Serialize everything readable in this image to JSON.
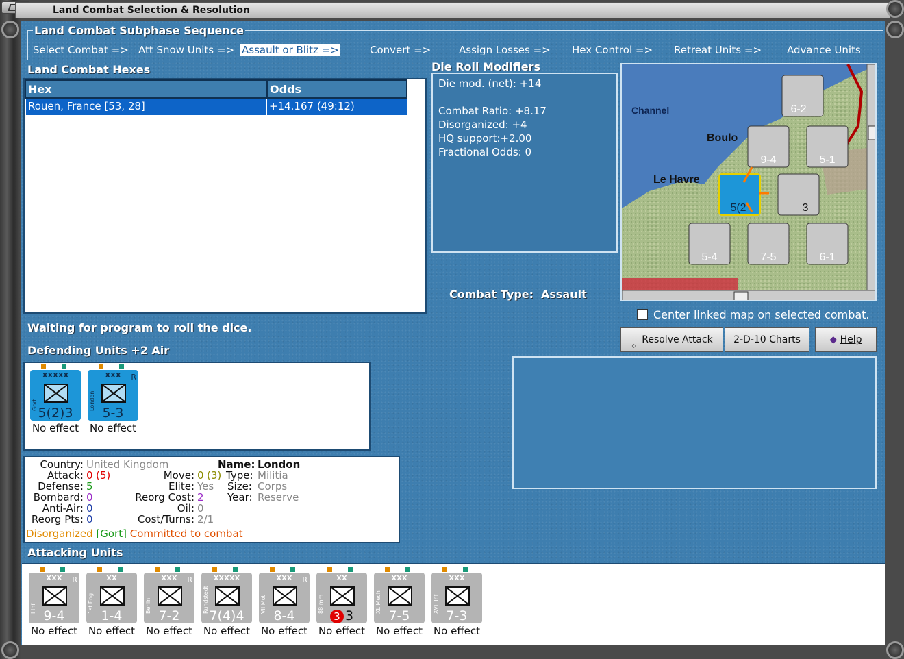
{
  "window": {
    "title": "Land Combat Selection & Resolution"
  },
  "phases": {
    "legend": "Land Combat Subphase Sequence",
    "items": [
      "Select Combat =>",
      "Att Snow Units =>",
      "Assault or Blitz =>",
      "Convert =>",
      "Assign Losses =>",
      "Hex Control =>",
      "Retreat Units =>",
      "Advance Units"
    ],
    "active_index": 2
  },
  "hexes": {
    "title": "Land Combat Hexes",
    "columns": [
      "Hex",
      "Odds"
    ],
    "rows": [
      {
        "hex": "Rouen, France [53, 28]",
        "odds": "+14.167 (49:12)"
      }
    ]
  },
  "die_roll": {
    "title": "Die Roll Modifiers",
    "lines": [
      "Die mod. (net): +14",
      "",
      "Combat Ratio: +8.17",
      "Disorganized: +4",
      "HQ support:+2.00",
      "Fractional Odds: 0"
    ]
  },
  "map": {
    "labels": [
      "Channel",
      "Boulo",
      "Le Havre"
    ],
    "units": [
      "6-2",
      "9-4",
      "5-1",
      "5(2",
      "3",
      "5-4",
      "7-5",
      "6-1"
    ]
  },
  "combat_type": {
    "label": "Combat Type:",
    "value": "Assault"
  },
  "status": "Waiting for program to roll the dice.",
  "center_map": {
    "label": "Center linked map on selected combat.",
    "checked": false
  },
  "buttons": {
    "resolve": "Resolve Attack",
    "charts": "2-D-10 Charts",
    "help": "Help"
  },
  "defenders": {
    "title": "Defending Units +2 Air",
    "units": [
      {
        "name": "Gort",
        "size": "XXXXX",
        "value": "5(2)3",
        "effect": "No effect",
        "reserve": ""
      },
      {
        "name": "London",
        "size": "XXX",
        "value": "5-3",
        "effect": "No effect",
        "reserve": "R"
      }
    ]
  },
  "info": {
    "country_label": "Country:",
    "country": "United Kingdom",
    "name_label": "Name:",
    "name": "London",
    "attack_label": "Attack:",
    "attack": "0",
    "attack_paren": "(5)",
    "move_label": "Move:",
    "move": "0",
    "move_paren": "(3)",
    "type_label": "Type:",
    "type": "Militia",
    "defense_label": "Defense:",
    "defense": "5",
    "elite_label": "Elite:",
    "elite": "Yes",
    "size_label": "Size:",
    "size": "Corps",
    "bombard_label": "Bombard:",
    "bombard": "0",
    "reorg_cost_label": "Reorg Cost:",
    "reorg_cost": "2",
    "year_label": "Year:",
    "year": "Reserve",
    "antiair_label": "Anti-Air:",
    "antiair": "0",
    "oil_label": "Oil:",
    "oil": "0",
    "reorg_pts_label": "Reorg Pts:",
    "reorg_pts": "0",
    "cost_turns_label": "Cost/Turns:",
    "cost_turns": "2/1",
    "status_disorg": "Disorganized",
    "status_gort": "[Gort]",
    "status_committed": "Committed to combat"
  },
  "attackers": {
    "title": "Attacking Units",
    "units": [
      {
        "name": "I Inf",
        "size": "XXX",
        "value": "9-4",
        "effect": "No effect",
        "reserve": "R"
      },
      {
        "name": "1st Eng",
        "size": "XX",
        "value": "1-4",
        "effect": "No effect",
        "reserve": ""
      },
      {
        "name": "Berlin",
        "size": "XXX",
        "value": "7-2",
        "effect": "No effect",
        "reserve": "R"
      },
      {
        "name": "Rundstedt",
        "size": "XXXXX",
        "value": "7(4)4",
        "effect": "No effect",
        "reserve": ""
      },
      {
        "name": "VII Mot",
        "size": "XXX",
        "value": "8-4",
        "effect": "No effect",
        "reserve": "R"
      },
      {
        "name": "88 mm",
        "size": "XX",
        "value": "3",
        "badge": "3",
        "effect": "No effect",
        "reserve": ""
      },
      {
        "name": "XL Mech",
        "size": "XXX",
        "value": "7-5",
        "effect": "No effect",
        "reserve": ""
      },
      {
        "name": "XVII Inf",
        "size": "XXX",
        "value": "7-3",
        "effect": "No effect",
        "reserve": ""
      }
    ]
  },
  "colors": {
    "panel_blue": "#3e7eaf",
    "selection_blue": "#0d64c8",
    "allied_unit": "#1d96d8",
    "axis_unit": "#b4b4b4",
    "red": "#e00000",
    "green": "#1a9a1a",
    "purple": "#9b2cc8",
    "orange": "#e08a00"
  }
}
